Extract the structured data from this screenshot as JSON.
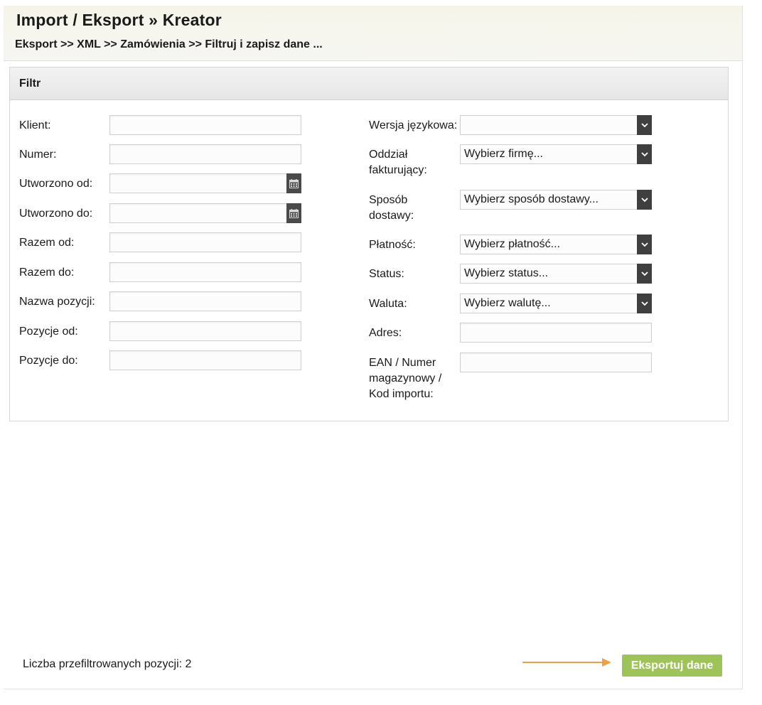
{
  "header": {
    "title": "Import / Eksport » Kreator",
    "breadcrumb": "Eksport >> XML >> Zamówienia >> Filtruj i zapisz dane ..."
  },
  "filter": {
    "title": "Filtr",
    "left_fields": {
      "klient": {
        "label": "Klient:",
        "value": ""
      },
      "numer": {
        "label": "Numer:",
        "value": ""
      },
      "utworzono_od": {
        "label": "Utworzono od:",
        "value": ""
      },
      "utworzono_do": {
        "label": "Utworzono do:",
        "value": ""
      },
      "razem_od": {
        "label": "Razem od:",
        "value": ""
      },
      "razem_do": {
        "label": "Razem do:",
        "value": ""
      },
      "nazwa_pozycji": {
        "label": "Nazwa pozycji:",
        "value": ""
      },
      "pozycje_od": {
        "label": "Pozycje od:",
        "value": ""
      },
      "pozycje_do": {
        "label": "Pozycje do:",
        "value": ""
      }
    },
    "right_fields": {
      "wersja_jezykowa": {
        "label": "Wersja językowa:",
        "value": ""
      },
      "oddzial_fakturujacy": {
        "label_line1": "Oddział",
        "label_line2": "fakturujący:",
        "value": "Wybierz firmę..."
      },
      "sposob_dostawy": {
        "label_line1": "Sposób",
        "label_line2": "dostawy:",
        "value": "Wybierz sposób dostawy..."
      },
      "platnosc": {
        "label": "Płatność:",
        "value": "Wybierz płatność..."
      },
      "status": {
        "label": "Status:",
        "value": "Wybierz status..."
      },
      "waluta": {
        "label": "Waluta:",
        "value": "Wybierz walutę..."
      },
      "adres": {
        "label": "Adres:",
        "value": ""
      },
      "ean": {
        "label_line1": "EAN / Numer",
        "label_line2": "magazynowy /",
        "label_line3": "Kod importu:",
        "value": ""
      }
    }
  },
  "footer": {
    "count_text": "Liczba przefiltrowanych pozycji: 2",
    "export_label": "Eksportuj dane"
  },
  "icons": {
    "calendar": "calendar-icon",
    "dropdown": "chevron-down-icon",
    "arrow": "arrow-right-icon"
  },
  "colors": {
    "export_button": "#9ec459",
    "arrow": "#f0a040",
    "select_arrow_bg": "#3f3f3f"
  }
}
